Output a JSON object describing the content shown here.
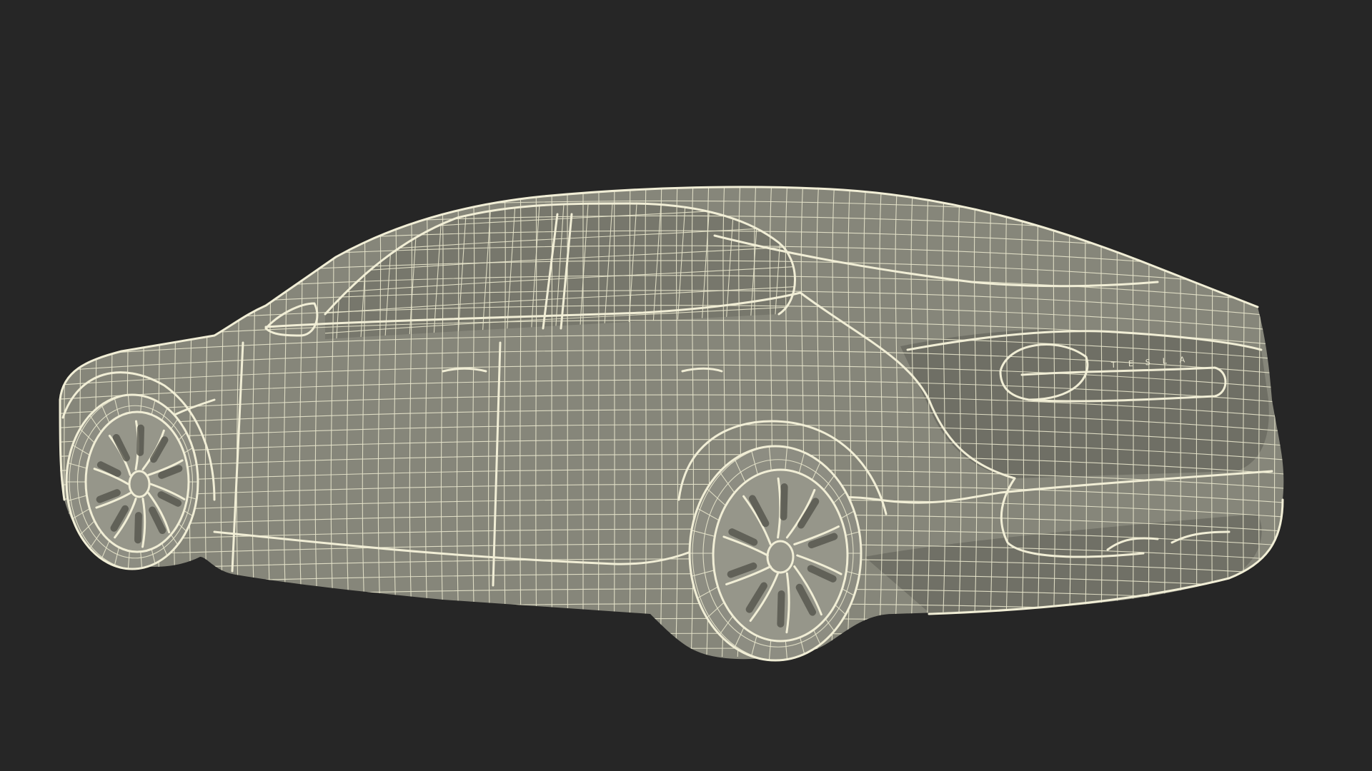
{
  "scene": {
    "background": "#262626",
    "wireframe_color": "#f1eed6",
    "surface_color": "#86867a",
    "subject": "car-wireframe"
  },
  "badge": {
    "letters": [
      "T",
      "E",
      "S",
      "L",
      "A"
    ],
    "color": "#ece9d2"
  }
}
